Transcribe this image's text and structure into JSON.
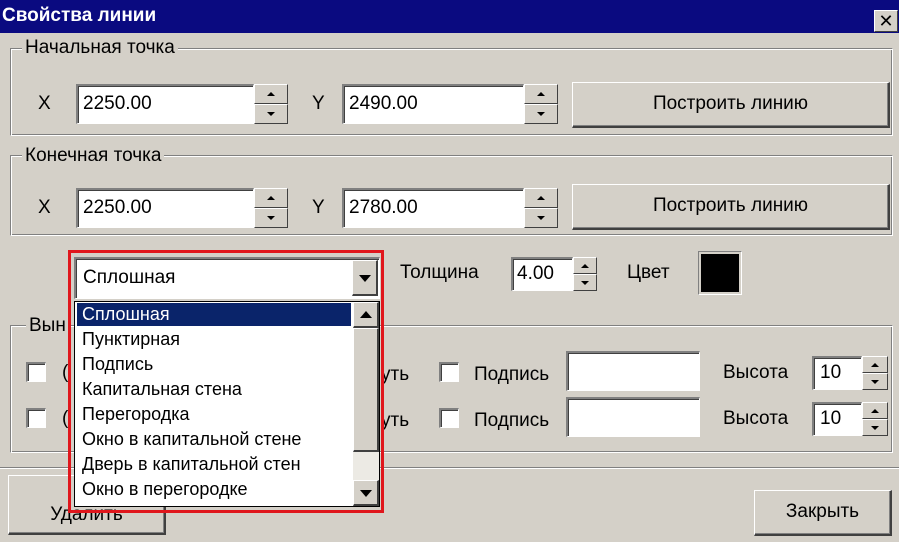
{
  "window": {
    "title": "Свойства линии",
    "close_glyph": "✕"
  },
  "start_point": {
    "legend": "Начальная точка",
    "x_label": "X",
    "x_value": "2250.00",
    "y_label": "Y",
    "y_value": "2490.00",
    "build_button": "Построить линию"
  },
  "end_point": {
    "legend": "Конечная точка",
    "x_label": "X",
    "x_value": "2250.00",
    "y_label": "Y",
    "y_value": "2780.00",
    "build_button": "Построить линию"
  },
  "line_style": {
    "selected": "Сплошная",
    "thickness_label": "Толщина",
    "thickness_value": "4.00",
    "color_label": "Цвет",
    "color_value": "#000000",
    "options": [
      "Сплошная",
      "Пунктирная",
      "Подпись",
      "Капитальная стена",
      "Перегородка",
      "Окно в капитальной стене",
      "Дверь в капитальной стен",
      "Окно в перегородке"
    ],
    "highlighted_index": 0
  },
  "callouts": {
    "legend_partial": "Вын",
    "rows": [
      {
        "partial_left": "(",
        "partial_text": "уть",
        "caption_label": "Подпись",
        "caption_value": "",
        "height_label": "Высота",
        "height_value": "10"
      },
      {
        "partial_left": "(",
        "partial_text": "уть",
        "caption_label": "Подпись",
        "caption_value": "",
        "height_label": "Высота",
        "height_value": "10"
      }
    ]
  },
  "footer": {
    "delete_button": "Удалить",
    "close_button": "Закрыть"
  },
  "accent": {
    "highlight_box": "#e0161c",
    "selection": "#0a246a",
    "titlebar": "#0a0a80"
  }
}
